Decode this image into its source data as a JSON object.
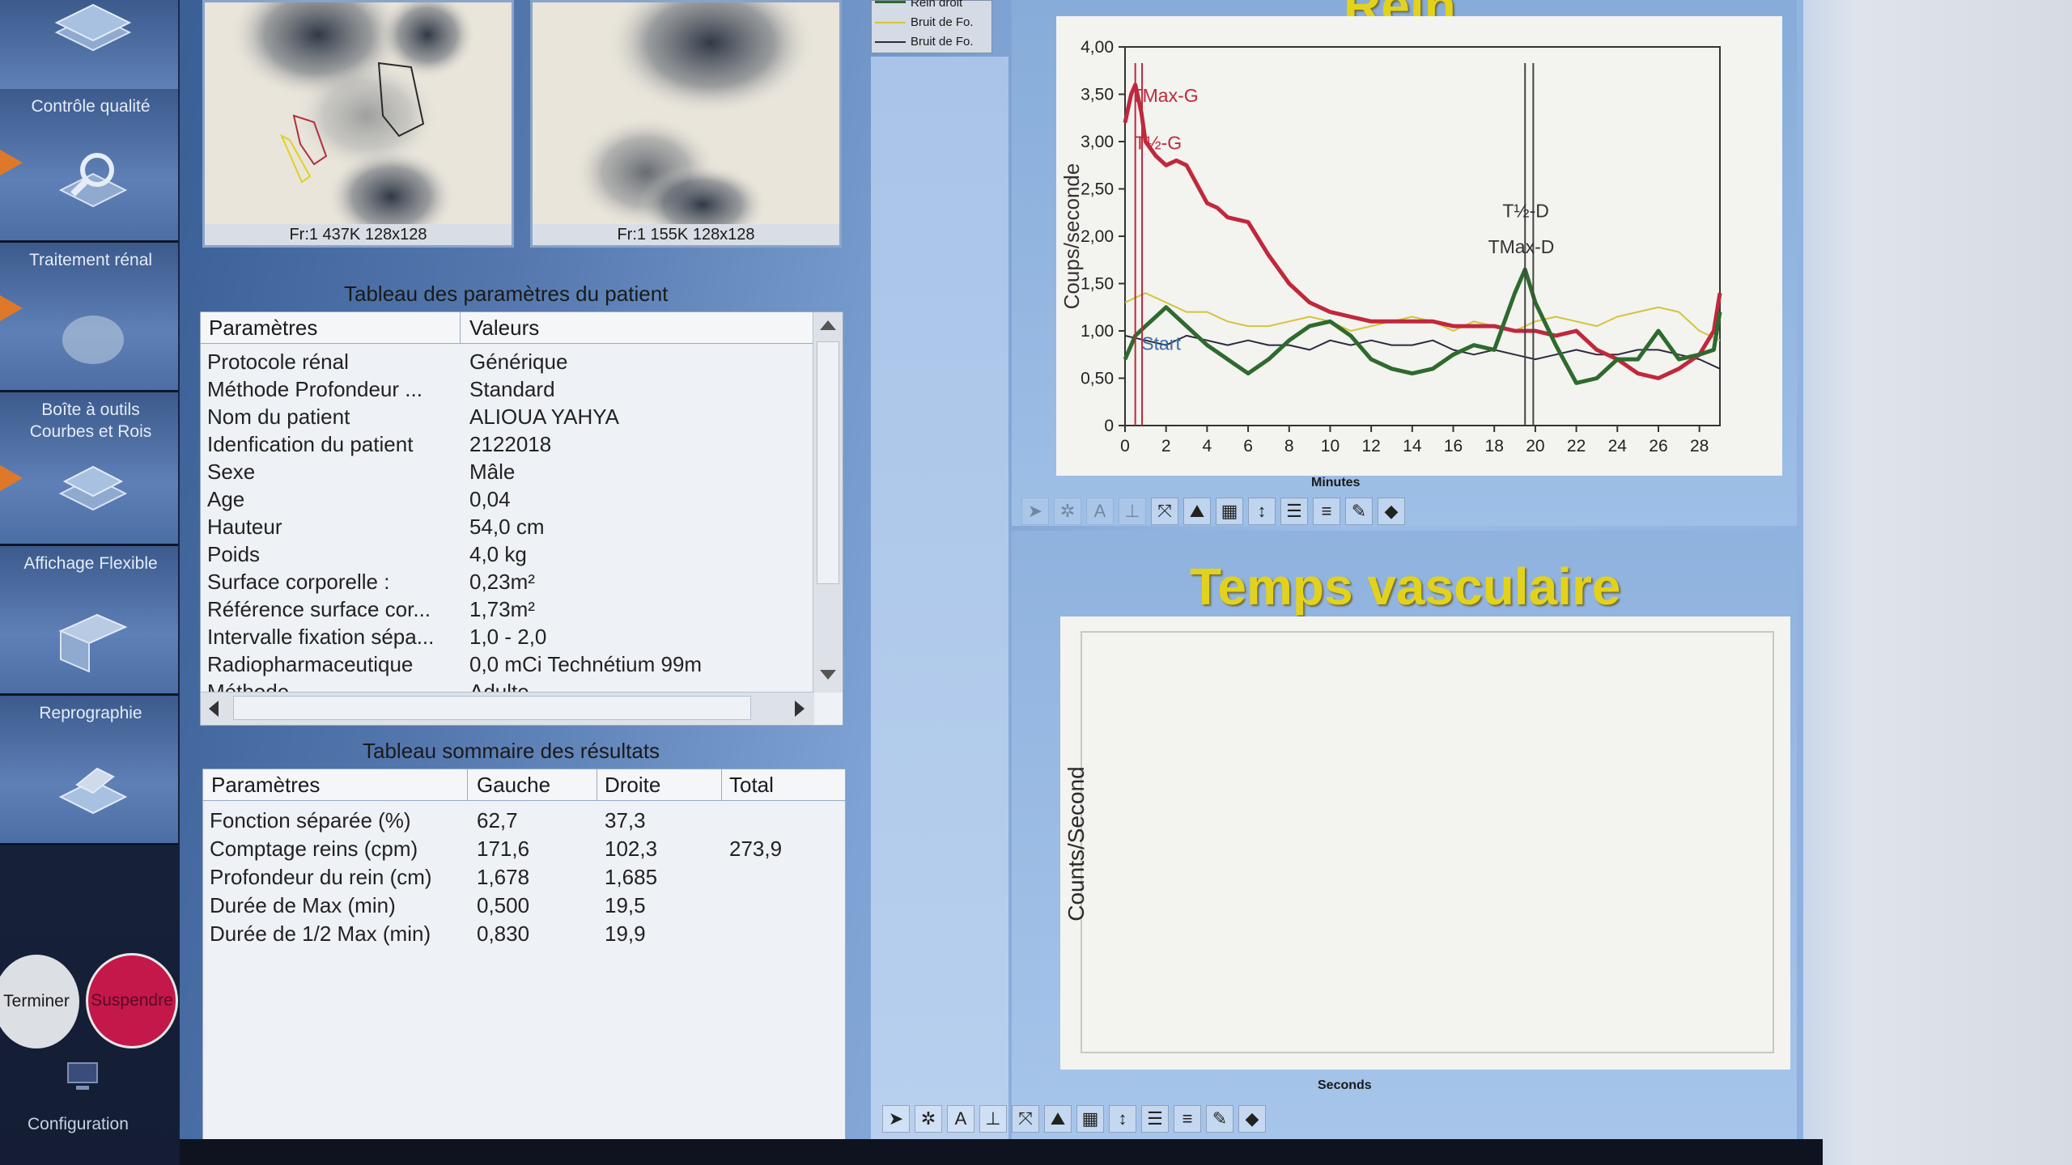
{
  "sidebar": {
    "items": [
      {
        "label": ""
      },
      {
        "label": "Contrôle qualité"
      },
      {
        "label": "Traitement rénal"
      },
      {
        "label": "Boîte à outils Courbes et Rois"
      },
      {
        "label": "Affichage Flexible"
      },
      {
        "label": "Reprographie"
      }
    ],
    "terminate_label": "Terminer",
    "suspend_label": "Suspendre",
    "config_label": "Configuration"
  },
  "scans": {
    "left_caption": "Fr:1 437K 128x128",
    "right_caption": "Fr:1 155K 128x128"
  },
  "legend": {
    "items": [
      "Rein droit",
      "Bruit de Fo.",
      "Bruit de Fo."
    ]
  },
  "patient_table": {
    "title": "Tableau des paramètres du patient",
    "headers": [
      "Paramètres",
      "Valeurs"
    ],
    "rows": [
      [
        "Protocole rénal",
        "Générique"
      ],
      [
        "Méthode Profondeur ...",
        "Standard"
      ],
      [
        "Nom du patient",
        "ALIOUA YAHYA"
      ],
      [
        "Idenfication du patient",
        "2122018"
      ],
      [
        "Sexe",
        "Mâle"
      ],
      [
        "Age",
        "0,04"
      ],
      [
        "Hauteur",
        "54,0 cm"
      ],
      [
        "Poids",
        "4,0 kg"
      ],
      [
        "Surface corporelle :",
        "0,23m²"
      ],
      [
        "Référence surface cor...",
        "1,73m²"
      ],
      [
        "Intervalle fixation sépa...",
        "1,0 - 2,0"
      ],
      [
        "Radiopharmaceutique",
        "0,0 mCi Technétium 99m"
      ],
      [
        "Méthode",
        "Adulte"
      ]
    ]
  },
  "results_table": {
    "title": "Tableau sommaire des résultats",
    "headers": [
      "Paramètres",
      "Gauche",
      "Droite",
      "Total"
    ],
    "rows": [
      [
        "Fonction séparée (%)",
        "62,7",
        "37,3",
        ""
      ],
      [
        "Comptage reins (cpm)",
        "171,6",
        "102,3",
        "273,9"
      ],
      [
        "Profondeur du rein (cm)",
        "1,678",
        "1,685",
        ""
      ],
      [
        "Durée de Max (min)",
        "0,500",
        "19,5",
        ""
      ],
      [
        "Durée de  1/2 Max (min)",
        "0,830",
        "19,9",
        ""
      ]
    ]
  },
  "renal_chart_title": "Rein",
  "vascular_chart_title": "Temps vasculaire",
  "chart_data": [
    {
      "type": "line",
      "title": "Rein",
      "xlabel": "Minutes",
      "ylabel": "Coups/seconde",
      "xlim": [
        0,
        29
      ],
      "ylim": [
        0,
        4
      ],
      "xticks": [
        "0",
        "2",
        "4",
        "6",
        "8",
        "10",
        "12",
        "14",
        "16",
        "18",
        "20",
        "22",
        "24",
        "26",
        "28"
      ],
      "yticks": [
        "0",
        "0,50",
        "1,00",
        "1,50",
        "2,00",
        "2,50",
        "3,00",
        "3,50",
        "4,00"
      ],
      "annotations": [
        "TMax-G",
        "T½-G",
        "T½-D",
        "TMax-D",
        "Start"
      ],
      "colors": {
        "left": "#c0283c",
        "right": "#2e6a2e",
        "bg1": "#d4c43a",
        "bg2": "#2a2a40"
      },
      "series": [
        {
          "x": [
            0,
            0.3,
            0.5,
            0.8,
            1,
            1.5,
            2,
            2.5,
            3,
            4,
            4.5,
            5,
            6,
            7,
            8,
            9,
            10,
            11,
            12,
            13,
            14,
            15,
            16,
            17,
            18,
            19,
            20,
            21,
            22,
            23,
            24,
            25,
            26,
            27,
            28,
            28.7,
            29
          ],
          "y": [
            3.2,
            3.5,
            3.6,
            3.3,
            3.0,
            2.85,
            2.75,
            2.8,
            2.75,
            2.35,
            2.3,
            2.2,
            2.15,
            1.8,
            1.5,
            1.3,
            1.2,
            1.15,
            1.1,
            1.1,
            1.1,
            1.1,
            1.05,
            1.05,
            1.05,
            1.0,
            1.0,
            0.95,
            1.0,
            0.8,
            0.7,
            0.55,
            0.5,
            0.6,
            0.75,
            1.0,
            1.4
          ]
        },
        {
          "x": [
            0,
            0.5,
            1,
            1.5,
            2,
            3,
            4,
            5,
            6,
            7,
            8,
            9,
            10,
            11,
            12,
            13,
            14,
            15,
            16,
            17,
            18,
            19,
            19.5,
            20,
            21,
            22,
            23,
            24,
            25,
            26,
            27,
            28,
            28.7,
            29
          ],
          "y": [
            0.7,
            0.95,
            1.05,
            1.15,
            1.25,
            1.05,
            0.85,
            0.7,
            0.55,
            0.7,
            0.9,
            1.05,
            1.1,
            0.95,
            0.7,
            0.6,
            0.55,
            0.6,
            0.75,
            0.85,
            0.8,
            1.4,
            1.65,
            1.3,
            0.85,
            0.45,
            0.5,
            0.7,
            0.7,
            1.0,
            0.7,
            0.75,
            0.8,
            1.2
          ]
        },
        {
          "x": [
            0,
            1,
            2,
            3,
            4,
            5,
            6,
            7,
            8,
            9,
            10,
            11,
            12,
            13,
            14,
            15,
            16,
            17,
            18,
            19,
            20,
            21,
            22,
            23,
            24,
            25,
            26,
            27,
            28,
            29
          ],
          "y": [
            1.3,
            1.4,
            1.3,
            1.2,
            1.2,
            1.1,
            1.05,
            1.05,
            1.1,
            1.15,
            1.1,
            1.0,
            1.05,
            1.1,
            1.15,
            1.1,
            1.0,
            1.1,
            1.05,
            1.0,
            1.1,
            1.15,
            1.1,
            1.05,
            1.15,
            1.2,
            1.25,
            1.2,
            1.0,
            0.9
          ]
        },
        {
          "x": [
            0,
            1,
            2,
            3,
            4,
            5,
            6,
            7,
            8,
            9,
            10,
            11,
            12,
            13,
            14,
            15,
            16,
            17,
            18,
            19,
            20,
            21,
            22,
            23,
            24,
            25,
            26,
            27,
            28,
            29
          ],
          "y": [
            0.95,
            0.9,
            0.85,
            0.95,
            0.9,
            0.85,
            0.9,
            0.85,
            0.85,
            0.8,
            0.9,
            0.85,
            0.9,
            0.85,
            0.85,
            0.9,
            0.8,
            0.75,
            0.8,
            0.75,
            0.7,
            0.75,
            0.8,
            0.75,
            0.75,
            0.8,
            0.8,
            0.75,
            0.7,
            0.6
          ]
        }
      ]
    },
    {
      "type": "line",
      "title": "Temps vasculaire",
      "xlabel": "Seconds",
      "ylabel": "Counts/Second",
      "series": []
    }
  ]
}
